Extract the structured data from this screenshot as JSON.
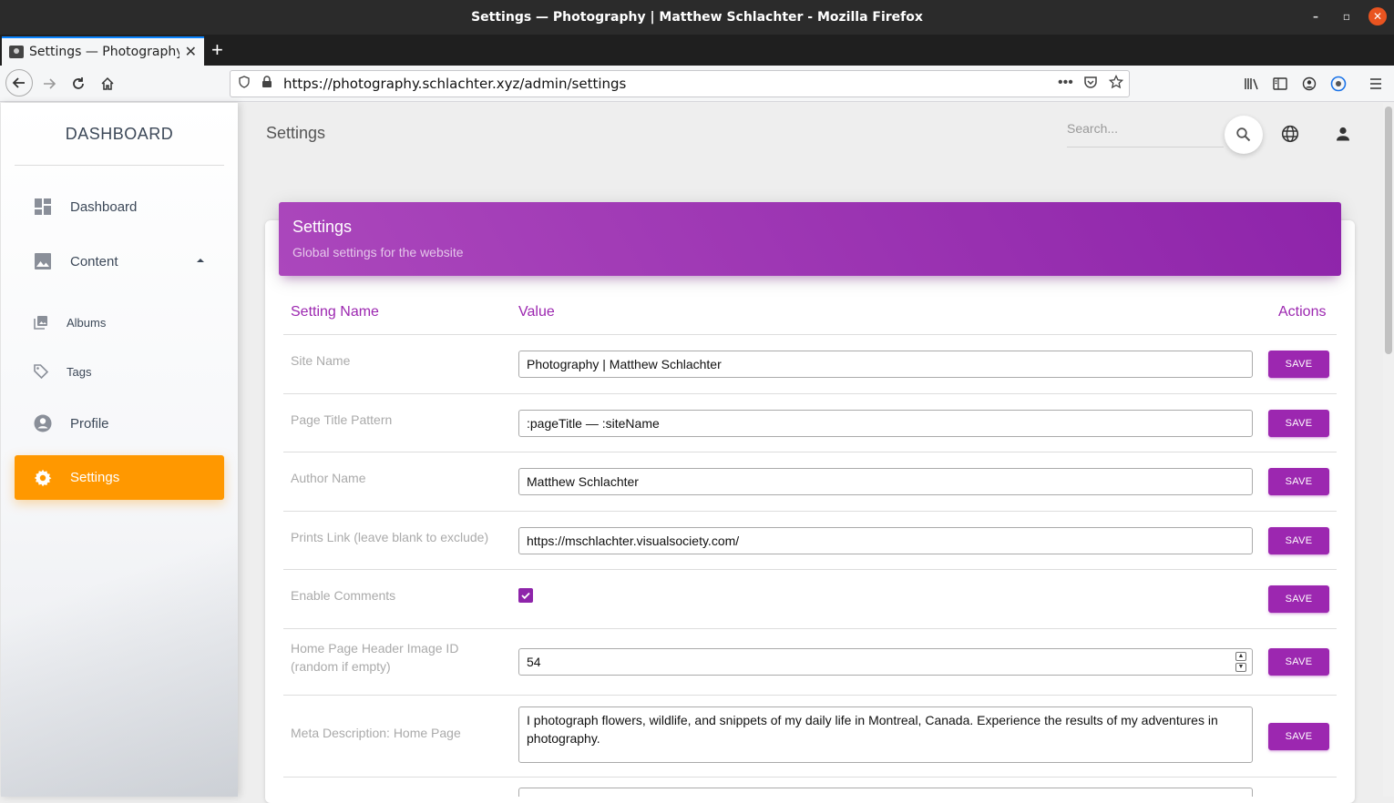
{
  "window": {
    "title": "Settings — Photography | Matthew Schlachter - Mozilla Firefox"
  },
  "browser": {
    "tab_title": "Settings — Photography | Matthew Schlachter",
    "url": "https://photography.schlachter.xyz/admin/settings"
  },
  "sidebar": {
    "brand": "DASHBOARD",
    "items": [
      {
        "label": "Dashboard",
        "icon": "dashboard-icon"
      },
      {
        "label": "Content",
        "icon": "image-icon"
      },
      {
        "label": "Albums",
        "icon": "collections-icon"
      },
      {
        "label": "Tags",
        "icon": "tag-icon"
      },
      {
        "label": "Profile",
        "icon": "account-circle-icon"
      },
      {
        "label": "Settings",
        "icon": "gear-icon"
      }
    ]
  },
  "header": {
    "page_title": "Settings",
    "search_placeholder": "Search..."
  },
  "card": {
    "title": "Settings",
    "subtitle": "Global settings for the website",
    "columns": [
      "Setting Name",
      "Value",
      "Actions"
    ]
  },
  "settings": [
    {
      "name": "Site Name",
      "value": "Photography | Matthew Schlachter",
      "action": "SAVE"
    },
    {
      "name": "Page Title Pattern",
      "value": ":pageTitle — :siteName",
      "action": "SAVE"
    },
    {
      "name": "Author Name",
      "value": "Matthew Schlachter",
      "action": "SAVE"
    },
    {
      "name": "Prints Link (leave blank to exclude)",
      "value": "https://mschlachter.visualsociety.com/",
      "action": "SAVE"
    },
    {
      "name": "Enable Comments",
      "checked": true,
      "action": "SAVE"
    },
    {
      "name": "Home Page Header Image ID (random if empty)",
      "value": "54",
      "action": "SAVE"
    },
    {
      "name": "Meta Description: Home Page",
      "value": "I photograph flowers, wildlife, and snippets of my daily life in Montreal, Canada. Experience the results of my adventures in photography.",
      "action": "SAVE"
    }
  ],
  "colors": {
    "primary": "#9c27b0",
    "active_nav": "#ff9800",
    "firefox_accent": "#0a84ff"
  }
}
